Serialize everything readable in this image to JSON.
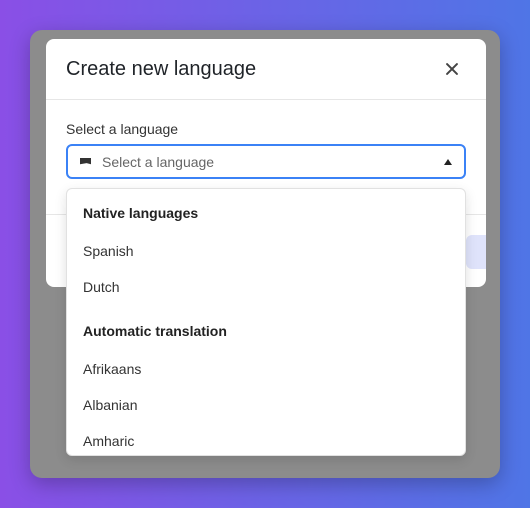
{
  "modal": {
    "title": "Create new language",
    "close_icon": "close-icon"
  },
  "field": {
    "label": "Select a language",
    "placeholder": "Select a language",
    "leading_icon": "flag-icon",
    "trailing_icon": "caret-up-icon"
  },
  "dropdown": {
    "groups": [
      {
        "heading": "Native languages",
        "options": [
          "Spanish",
          "Dutch"
        ]
      },
      {
        "heading": "Automatic translation",
        "options": [
          "Afrikaans",
          "Albanian",
          "Amharic"
        ]
      }
    ]
  },
  "colors": {
    "focus_ring": "#3b82f6",
    "backdrop": "#8c8c8c",
    "gradient_start": "#8a4fe6",
    "gradient_end": "#4f75e6"
  }
}
